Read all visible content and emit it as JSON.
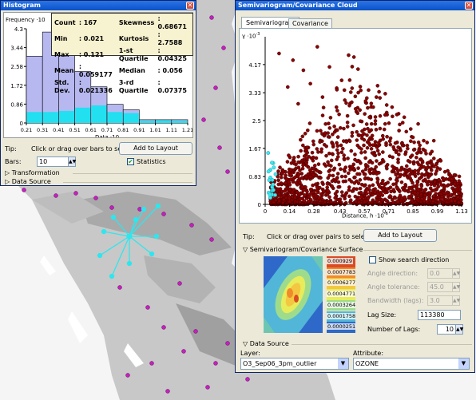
{
  "histogram": {
    "title": "Histogram",
    "y_label": "Frequency ·10",
    "x_label": "Data ·10",
    "y_ticks": [
      "4.3",
      "3.44",
      "2.58",
      "1.72",
      "0.86",
      "0"
    ],
    "x_ticks": [
      "0.21",
      "0.31",
      "0.41",
      "0.51",
      "0.61",
      "0.71",
      "0.81",
      "0.91",
      "1.01",
      "1.11",
      "1.21"
    ],
    "stats": [
      {
        "k": "Count",
        "v": ": 167",
        "k2": "Skewness",
        "v2": ": 0.68671"
      },
      {
        "k": "Min",
        "v": ": 0.021",
        "k2": "Kurtosis",
        "v2": ": 2.7588"
      },
      {
        "k": "Max",
        "v": ": 0.121",
        "k2": "1-st Quartile",
        "v2": ": 0.04325"
      },
      {
        "k": "Mean",
        "v": ": 0.059177",
        "k2": "Median",
        "v2": ": 0.056"
      },
      {
        "k": "Std. Dev.",
        "v": ": 0.021336",
        "k2": "3-rd Quartile",
        "v2": ": 0.07375"
      }
    ],
    "tip_label": "Tip:",
    "tip_text": "Click or drag over bars to select",
    "add_button": "Add to Layout",
    "bars_label": "Bars:",
    "bars_value": "10",
    "statistics_label": "Statistics",
    "transformation_label": "Transformation",
    "data_source_label": "Data Source",
    "colors": {
      "bar": "#b7b8f0",
      "selected": "#22e0f0"
    }
  },
  "semivariogram": {
    "title": "Semivariogram/Covariance Cloud",
    "tabs": [
      "Semivariogram",
      "Covariance"
    ],
    "y_label": "γ ·10",
    "y_exp": "-3",
    "x_label": "Distance, h ·10",
    "x_exp": "-6",
    "y_ticks": [
      "4.17",
      "3.33",
      "2.5",
      "1.67",
      "0.83",
      "0"
    ],
    "x_ticks": [
      "0",
      "0.14",
      "0.28",
      "0.43",
      "0.57",
      "0.71",
      "0.85",
      "0.99",
      "1.13"
    ],
    "tip_label": "Tip:",
    "tip_text": "Click or drag over pairs to select",
    "add_button": "Add to Layout",
    "surface_label": "Semivariogram/Covariance Surface",
    "legend_values": [
      "0.000929",
      "0.0007783",
      "0.0006277",
      "0.0004771",
      "0.0003264",
      "0.0001758",
      "0.00002513"
    ],
    "legend_colors": [
      "#d94b24",
      "#f08a2a",
      "#f4c742",
      "#e8ec5a",
      "#9edc8c",
      "#52b6d8",
      "#2e68c8"
    ],
    "show_search_direction": "Show search direction",
    "angle_direction_label": "Angle direction:",
    "angle_direction_value": "0.0",
    "angle_tolerance_label": "Angle tolerance:",
    "angle_tolerance_value": "45.0",
    "bandwidth_label": "Bandwidth (lags):",
    "bandwidth_value": "3.0",
    "lag_size_label": "Lag Size:",
    "lag_size_value": "113380",
    "num_lags_label": "Number of Lags:",
    "num_lags_value": "10",
    "data_source_label": "Data Source",
    "layer_label": "Layer:",
    "layer_value": "O3_Sep06_3pm_outlier",
    "attribute_label": "Attribute:",
    "attribute_value": "OZONE",
    "colors": {
      "point": "#8b0000",
      "selected": "#3ee8f0"
    }
  },
  "chart_data": [
    {
      "type": "bar",
      "title": "Histogram",
      "xlabel": "Data ·10",
      "ylabel": "Frequency ·10",
      "bin_edges": [
        0.21,
        0.31,
        0.41,
        0.51,
        0.61,
        0.71,
        0.81,
        0.91,
        1.01,
        1.11,
        1.21
      ],
      "series": [
        {
          "values": [
            3.05,
            4.15,
            3.6,
            2.35,
            1.65,
            0.85,
            0.6,
            0.15,
            0.15,
            0.15
          ]
        },
        {
          "values": [
            0.5,
            0.5,
            0.55,
            0.7,
            0.8,
            0.5,
            0.45,
            0.1,
            0.12,
            0.1
          ]
        }
      ],
      "ylim": [
        0,
        4.3
      ]
    },
    {
      "type": "scatter",
      "title": "Semivariogram/Covariance Cloud",
      "xlabel": "Distance, h ·10-6",
      "ylabel": "γ ·10-3",
      "xlim": [
        0,
        1.13
      ],
      "ylim": [
        0,
        5.0
      ],
      "series": [
        {
          "points": [
            [
              0.08,
              4.5
            ],
            [
              0.13,
              3.5
            ],
            [
              0.16,
              4.3
            ],
            [
              0.19,
              3.0
            ],
            [
              0.22,
              4.0
            ],
            [
              0.26,
              3.6
            ],
            [
              0.3,
              4.7
            ],
            [
              0.33,
              3.2
            ],
            [
              0.37,
              4.1
            ],
            [
              0.41,
              2.9
            ],
            [
              0.44,
              3.7
            ],
            [
              0.48,
              4.45
            ],
            [
              0.52,
              2.85
            ],
            [
              0.55,
              3.4
            ],
            [
              0.6,
              2.6
            ],
            [
              0.64,
              3.2
            ],
            [
              0.69,
              2.4
            ],
            [
              0.73,
              2.9
            ],
            [
              0.77,
              2.2
            ],
            [
              0.8,
              2.6
            ],
            [
              0.85,
              2.0
            ],
            [
              0.88,
              2.4
            ],
            [
              0.92,
              1.6
            ],
            [
              0.97,
              1.9
            ],
            [
              1.01,
              1.3
            ],
            [
              1.05,
              1.0
            ],
            [
              1.09,
              0.6
            ],
            [
              1.12,
              0.45
            ]
          ]
        },
        {
          "points": [
            [
              0.02,
              0.35
            ],
            [
              0.03,
              0.8
            ],
            [
              0.04,
              0.55
            ],
            [
              0.05,
              1.1
            ],
            [
              0.03,
              0.2
            ],
            [
              0.06,
              0.9
            ],
            [
              0.04,
              0.4
            ]
          ]
        }
      ]
    }
  ]
}
